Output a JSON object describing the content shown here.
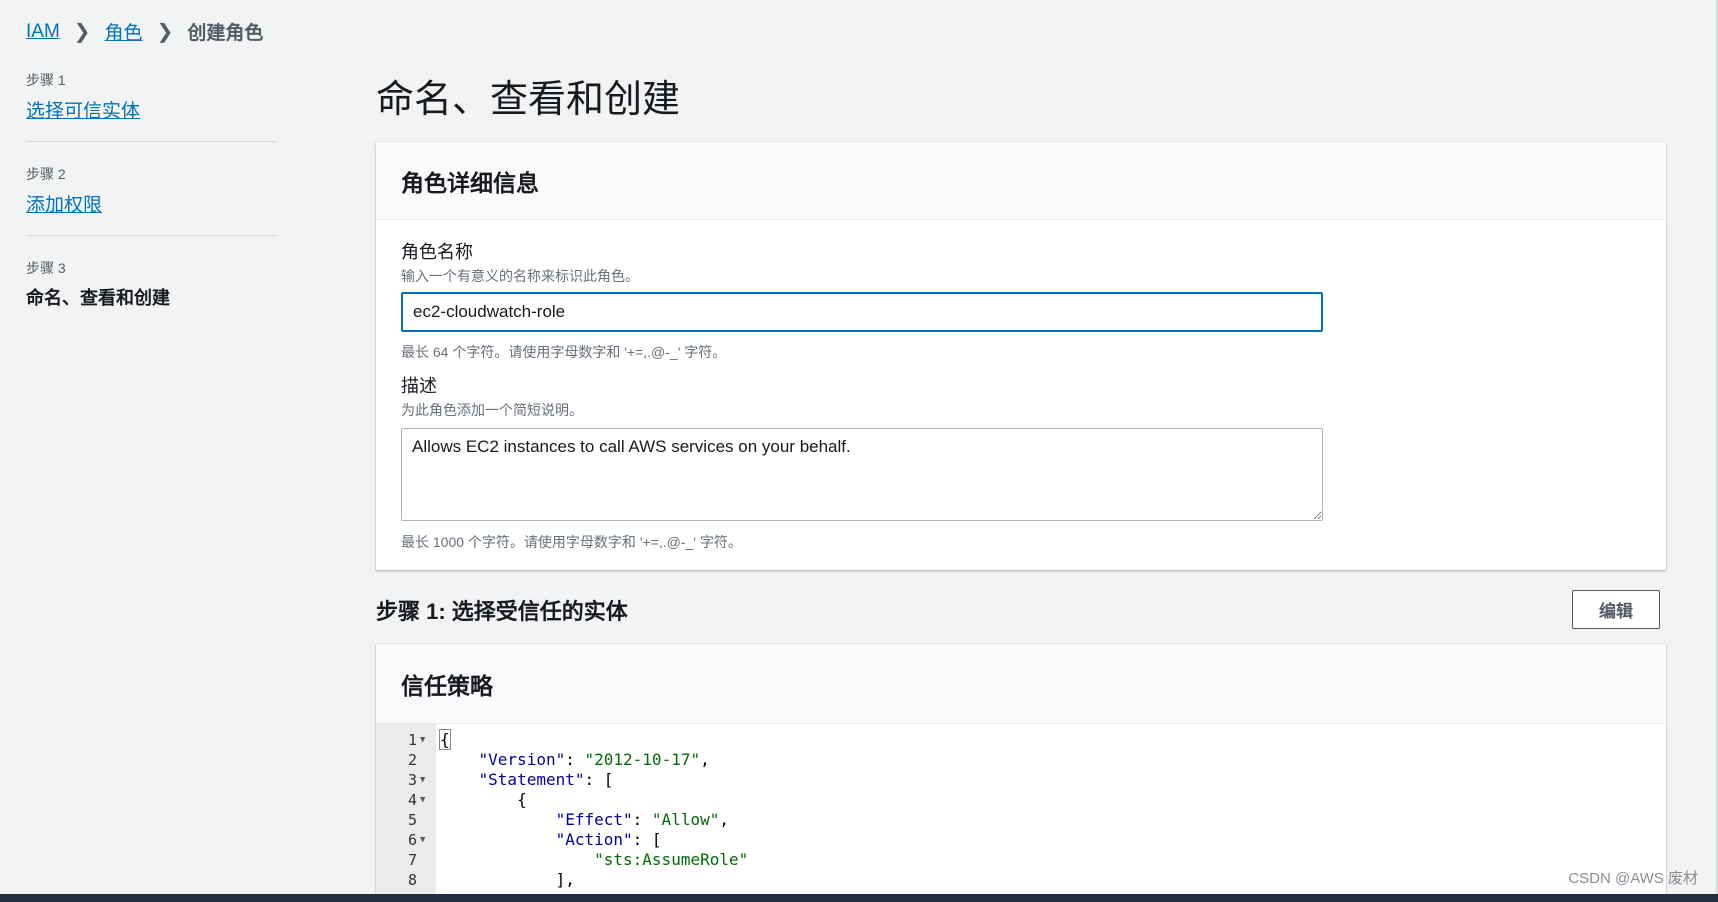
{
  "breadcrumb": {
    "items": [
      "IAM",
      "角色"
    ],
    "current": "创建角色"
  },
  "sidebar": {
    "steps": [
      {
        "num": "步骤 1",
        "label": "选择可信实体"
      },
      {
        "num": "步骤 2",
        "label": "添加权限"
      },
      {
        "num": "步骤 3",
        "label": "命名、查看和创建"
      }
    ]
  },
  "page": {
    "title": "命名、查看和创建"
  },
  "role_details": {
    "title": "角色详细信息",
    "name_label": "角色名称",
    "name_desc": "输入一个有意义的名称来标识此角色。",
    "name_value": "ec2-cloudwatch-role",
    "name_constraint": "最长 64 个字符。请使用字母数字和 '+=,.@-_' 字符。",
    "desc_label": "描述",
    "desc_desc": "为此角色添加一个简短说明。",
    "desc_value": "Allows EC2 instances to call AWS services on your behalf.",
    "desc_constraint": "最长 1000 个字符。请使用字母数字和 '+=,.@-_' 字符。"
  },
  "step1_section": {
    "heading": "步骤 1: 选择受信任的实体",
    "edit_label": "编辑"
  },
  "trust_policy": {
    "title": "信任策略",
    "line_numbers": [
      "1",
      "2",
      "3",
      "4",
      "5",
      "6",
      "7",
      "8"
    ],
    "lines": {
      "l1": "{",
      "l2_key": "\"Version\"",
      "l2_val": "\"2012-10-17\"",
      "l3_key": "\"Statement\"",
      "l3_tail": ": [",
      "l4": "{",
      "l5_key": "\"Effect\"",
      "l5_val": "\"Allow\"",
      "l6_key": "\"Action\"",
      "l6_tail": ": [",
      "l7_val": "\"sts:AssumeRole\"",
      "l8": "],"
    }
  },
  "watermark": "CSDN @AWS 废材",
  "colors": {
    "link": "#0073bb",
    "background": "#f2f3f3",
    "json_key": "#0000a2",
    "json_string": "#036a07"
  }
}
